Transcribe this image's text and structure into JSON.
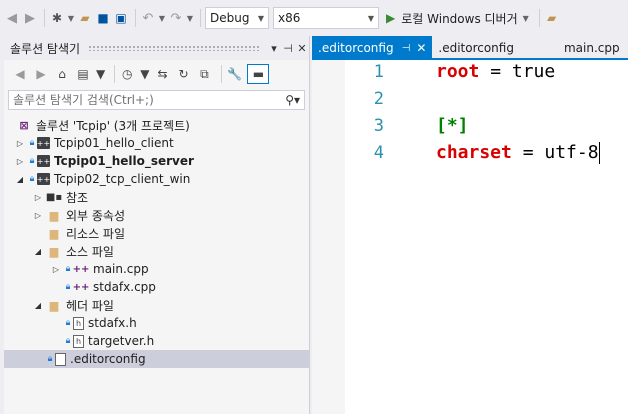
{
  "toolbar": {
    "configuration": "Debug",
    "platform": "x86",
    "run_label": "로컬 Windows 디버거"
  },
  "solution_explorer": {
    "title": "솔루션 탐색기",
    "search_placeholder": "솔루션 탐색기 검색(Ctrl+;)",
    "items": [
      {
        "label": "솔루션 'Tcpip' (3개 프로젝트)"
      },
      {
        "label": "Tcpip01_hello_client"
      },
      {
        "label": "Tcpip01_hello_server"
      },
      {
        "label": "Tcpip02_tcp_client_win"
      },
      {
        "label": "참조"
      },
      {
        "label": "외부 종속성"
      },
      {
        "label": "리소스 파일"
      },
      {
        "label": "소스 파일"
      },
      {
        "label": "main.cpp"
      },
      {
        "label": "stdafx.cpp"
      },
      {
        "label": "헤더 파일"
      },
      {
        "label": "stdafx.h"
      },
      {
        "label": "targetver.h"
      },
      {
        "label": ".editorconfig"
      }
    ]
  },
  "editor": {
    "tabs": [
      {
        "label": ".editorconfig"
      },
      {
        "label": ".editorconfig"
      },
      {
        "label": "main.cpp"
      }
    ],
    "lines": [
      {
        "num": "1",
        "key": "root",
        "eq": " = ",
        "val": "true"
      },
      {
        "num": "2"
      },
      {
        "num": "3",
        "section": "[*]"
      },
      {
        "num": "4",
        "key": "charset",
        "eq": " = ",
        "val": "utf-8"
      }
    ]
  }
}
